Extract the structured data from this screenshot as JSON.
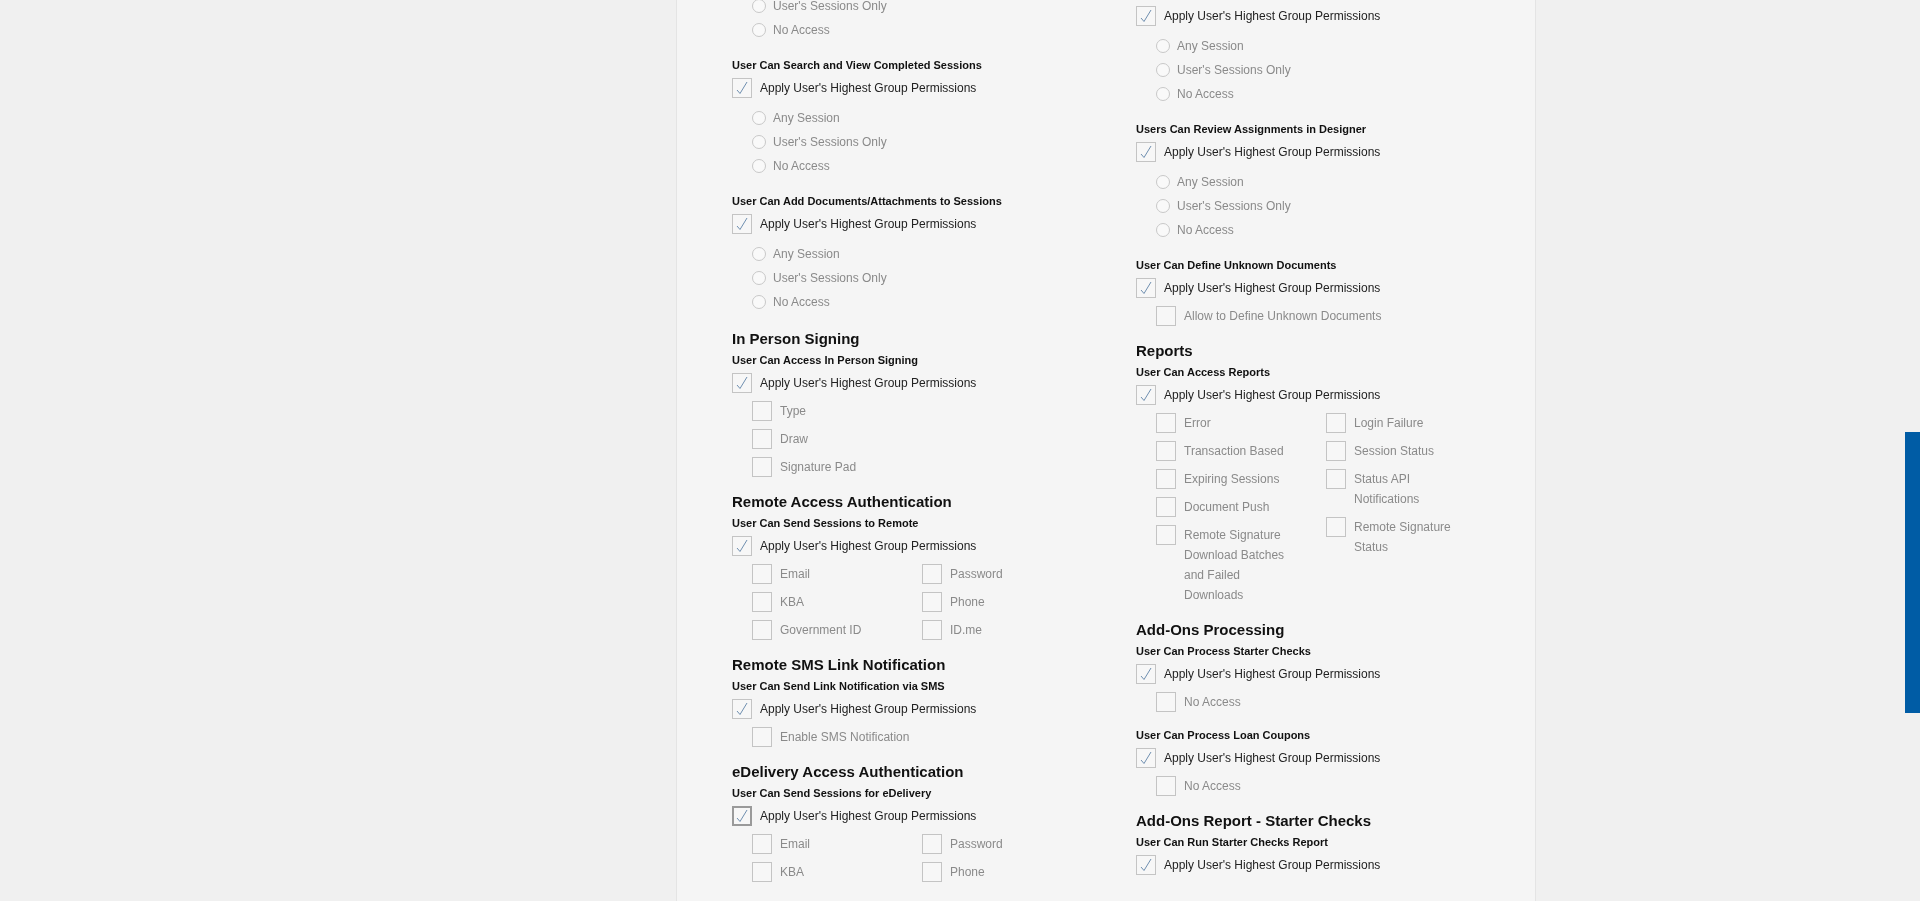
{
  "columns": [
    {
      "blocks": [
        {
          "options": {
            "columns": [
              [
                {
                  "kind": "radio",
                  "label": "User's Sessions Only",
                  "selected": false
                },
                {
                  "kind": "radio",
                  "label": "No Access",
                  "selected": false
                }
              ]
            ]
          }
        },
        {
          "title": "User Can Search and View Completed Sessions",
          "apply": {
            "label": "Apply User's Highest Group Permissions",
            "checked": true,
            "focused": false
          },
          "options": {
            "columns": [
              [
                {
                  "kind": "radio",
                  "label": "Any Session",
                  "selected": false
                },
                {
                  "kind": "radio",
                  "label": "User's Sessions Only",
                  "selected": false
                },
                {
                  "kind": "radio",
                  "label": "No Access",
                  "selected": false
                }
              ]
            ]
          }
        },
        {
          "title": "User Can Add Documents/Attachments to Sessions",
          "apply": {
            "label": "Apply User's Highest Group Permissions",
            "checked": true,
            "focused": false
          },
          "options": {
            "columns": [
              [
                {
                  "kind": "radio",
                  "label": "Any Session",
                  "selected": false
                },
                {
                  "kind": "radio",
                  "label": "User's Sessions Only",
                  "selected": false
                },
                {
                  "kind": "radio",
                  "label": "No Access",
                  "selected": false
                }
              ]
            ]
          }
        },
        {
          "section": "In Person Signing",
          "title": "User Can Access In Person Signing",
          "apply": {
            "label": "Apply User's Highest Group Permissions",
            "checked": true,
            "focused": false
          },
          "options": {
            "columns": [
              [
                {
                  "kind": "checkbox",
                  "label": "Type",
                  "checked": false
                },
                {
                  "kind": "checkbox",
                  "label": "Draw",
                  "checked": false
                },
                {
                  "kind": "checkbox",
                  "label": "Signature Pad",
                  "checked": false
                }
              ]
            ]
          }
        },
        {
          "section": "Remote Access Authentication",
          "title": "User Can Send Sessions to Remote",
          "apply": {
            "label": "Apply User's Highest Group Permissions",
            "checked": true,
            "focused": false
          },
          "options": {
            "columns": [
              [
                {
                  "kind": "checkbox",
                  "label": "Email",
                  "checked": false
                },
                {
                  "kind": "checkbox",
                  "label": "KBA",
                  "checked": false
                },
                {
                  "kind": "checkbox",
                  "label": "Government ID",
                  "checked": false
                }
              ],
              [
                {
                  "kind": "checkbox",
                  "label": "Password",
                  "checked": false
                },
                {
                  "kind": "checkbox",
                  "label": "Phone",
                  "checked": false
                },
                {
                  "kind": "checkbox",
                  "label": "ID.me",
                  "checked": false
                }
              ]
            ]
          }
        },
        {
          "section": "Remote SMS Link Notification",
          "title": "User Can Send Link Notification via SMS",
          "apply": {
            "label": "Apply User's Highest Group Permissions",
            "checked": true,
            "focused": false
          },
          "options": {
            "columns": [
              [
                {
                  "kind": "checkbox",
                  "label": "Enable SMS Notification",
                  "checked": false
                }
              ]
            ]
          }
        },
        {
          "section": "eDelivery Access Authentication",
          "title": "User Can Send Sessions for eDelivery",
          "apply": {
            "label": "Apply User's Highest Group Permissions",
            "checked": true,
            "focused": true
          },
          "options": {
            "columns": [
              [
                {
                  "kind": "checkbox",
                  "label": "Email",
                  "checked": false
                },
                {
                  "kind": "checkbox",
                  "label": "KBA",
                  "checked": false
                }
              ],
              [
                {
                  "kind": "checkbox",
                  "label": "Password",
                  "checked": false
                },
                {
                  "kind": "checkbox",
                  "label": "Phone",
                  "checked": false
                }
              ]
            ]
          }
        }
      ]
    },
    {
      "blocks": [
        {
          "apply": {
            "label": "Apply User's Highest Group Permissions",
            "checked": true,
            "focused": false
          },
          "options": {
            "columns": [
              [
                {
                  "kind": "radio",
                  "label": "Any Session",
                  "selected": false
                },
                {
                  "kind": "radio",
                  "label": "User's Sessions Only",
                  "selected": false
                },
                {
                  "kind": "radio",
                  "label": "No Access",
                  "selected": false
                }
              ]
            ]
          }
        },
        {
          "title": "Users Can Review Assignments in Designer",
          "apply": {
            "label": "Apply User's Highest Group Permissions",
            "checked": true,
            "focused": false
          },
          "options": {
            "columns": [
              [
                {
                  "kind": "radio",
                  "label": "Any Session",
                  "selected": false
                },
                {
                  "kind": "radio",
                  "label": "User's Sessions Only",
                  "selected": false
                },
                {
                  "kind": "radio",
                  "label": "No Access",
                  "selected": false
                }
              ]
            ]
          }
        },
        {
          "title": "User Can Define Unknown Documents",
          "apply": {
            "label": "Apply User's Highest Group Permissions",
            "checked": true,
            "focused": false
          },
          "options": {
            "columns": [
              [
                {
                  "kind": "checkbox",
                  "label": "Allow to Define Unknown Documents",
                  "checked": false
                }
              ]
            ]
          }
        },
        {
          "section": "Reports",
          "title": "User Can Access Reports",
          "apply": {
            "label": "Apply User's Highest Group Permissions",
            "checked": true,
            "focused": false
          },
          "options": {
            "columns": [
              [
                {
                  "kind": "checkbox",
                  "label": "Error",
                  "checked": false
                },
                {
                  "kind": "checkbox",
                  "label": "Transaction Based",
                  "checked": false
                },
                {
                  "kind": "checkbox",
                  "label": "Expiring Sessions",
                  "checked": false
                },
                {
                  "kind": "checkbox",
                  "label": "Document Push",
                  "checked": false
                },
                {
                  "kind": "checkbox",
                  "label": "Remote Signature Download Batches and Failed Downloads",
                  "checked": false
                }
              ],
              [
                {
                  "kind": "checkbox",
                  "label": "Login Failure",
                  "checked": false
                },
                {
                  "kind": "checkbox",
                  "label": "Session Status",
                  "checked": false
                },
                {
                  "kind": "checkbox",
                  "label": "Status API Notifications",
                  "checked": false
                },
                {
                  "kind": "checkbox",
                  "label": "Remote Signature Status",
                  "checked": false
                }
              ]
            ]
          }
        },
        {
          "section": "Add-Ons Processing",
          "title": "User Can Process Starter Checks",
          "apply": {
            "label": "Apply User's Highest Group Permissions",
            "checked": true,
            "focused": false
          },
          "options": {
            "columns": [
              [
                {
                  "kind": "checkbox",
                  "label": "No Access",
                  "checked": false
                }
              ]
            ]
          }
        },
        {
          "title": "User Can Process Loan Coupons",
          "apply": {
            "label": "Apply User's Highest Group Permissions",
            "checked": true,
            "focused": false
          },
          "options": {
            "columns": [
              [
                {
                  "kind": "checkbox",
                  "label": "No Access",
                  "checked": false
                }
              ]
            ]
          }
        },
        {
          "section": "Add-Ons Report - Starter Checks",
          "title": "User Can Run Starter Checks Report",
          "apply": {
            "label": "Apply User's Highest Group Permissions",
            "checked": true,
            "focused": false
          }
        }
      ]
    }
  ]
}
